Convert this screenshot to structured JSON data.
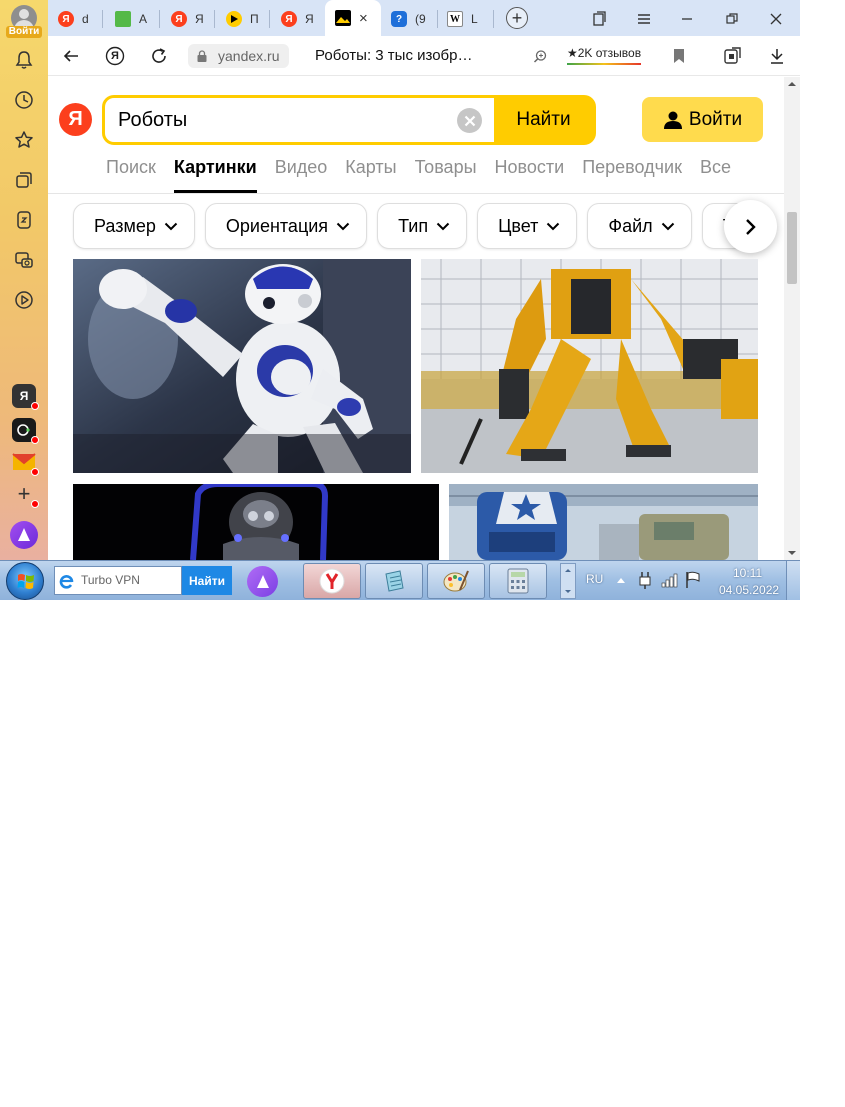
{
  "sidebar": {
    "login_label": "Войти",
    "yandex_app_letter": "Я",
    "accent": "#ffcc00"
  },
  "tabs": [
    {
      "letter": "d",
      "icon": "yandex-icon"
    },
    {
      "letter": "A",
      "icon": "green-square-icon"
    },
    {
      "letter": "Я",
      "icon": "yandex-icon"
    },
    {
      "letter": "П",
      "icon": "play-icon"
    },
    {
      "letter": "Я",
      "icon": "yandex-icon"
    },
    {
      "letter": "",
      "icon": "images-icon",
      "active": true,
      "close": "×"
    },
    {
      "letter": "(9",
      "icon": "question-icon"
    },
    {
      "letter": "L",
      "icon": "wikipedia-icon",
      "fav_letter": "W"
    }
  ],
  "addressbar": {
    "yandex_letter": "Я",
    "domain": "yandex.ru",
    "title": "Роботы: 3 тыс изобр…",
    "reviews": "★2K отзывов"
  },
  "page": {
    "logo_letter": "Я",
    "search_value": "Роботы",
    "find_label": "Найти",
    "login_label": "Войти",
    "nav": [
      "Поиск",
      "Картинки",
      "Видео",
      "Карты",
      "Товары",
      "Новости",
      "Переводчик",
      "Все"
    ],
    "active_nav": "Картинки",
    "filters": [
      "Размер",
      "Ориентация",
      "Тип",
      "Цвет",
      "Файл",
      "Т"
    ]
  },
  "taskbar": {
    "search_placeholder": "Turbo VPN",
    "find_label": "Найти",
    "lang": "RU",
    "time": "10:11",
    "date": "04.05.2022"
  },
  "colors": {
    "yandex_red": "#fc3f1d",
    "yellow": "#ffcc00",
    "tabbar": "#d8e4f6"
  }
}
